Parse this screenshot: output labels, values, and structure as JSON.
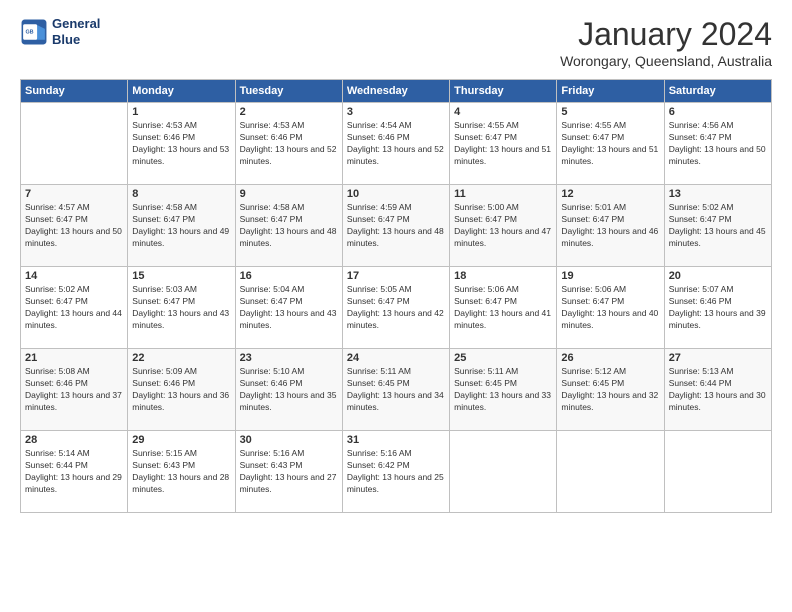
{
  "logo": {
    "line1": "General",
    "line2": "Blue"
  },
  "title": "January 2024",
  "subtitle": "Worongary, Queensland, Australia",
  "headers": [
    "Sunday",
    "Monday",
    "Tuesday",
    "Wednesday",
    "Thursday",
    "Friday",
    "Saturday"
  ],
  "weeks": [
    [
      null,
      {
        "day": "1",
        "sunrise": "4:53 AM",
        "sunset": "6:46 PM",
        "daylight": "13 hours and 53 minutes."
      },
      {
        "day": "2",
        "sunrise": "4:53 AM",
        "sunset": "6:46 PM",
        "daylight": "13 hours and 52 minutes."
      },
      {
        "day": "3",
        "sunrise": "4:54 AM",
        "sunset": "6:46 PM",
        "daylight": "13 hours and 52 minutes."
      },
      {
        "day": "4",
        "sunrise": "4:55 AM",
        "sunset": "6:47 PM",
        "daylight": "13 hours and 51 minutes."
      },
      {
        "day": "5",
        "sunrise": "4:55 AM",
        "sunset": "6:47 PM",
        "daylight": "13 hours and 51 minutes."
      },
      {
        "day": "6",
        "sunrise": "4:56 AM",
        "sunset": "6:47 PM",
        "daylight": "13 hours and 50 minutes."
      }
    ],
    [
      {
        "day": "7",
        "sunrise": "4:57 AM",
        "sunset": "6:47 PM",
        "daylight": "13 hours and 50 minutes."
      },
      {
        "day": "8",
        "sunrise": "4:58 AM",
        "sunset": "6:47 PM",
        "daylight": "13 hours and 49 minutes."
      },
      {
        "day": "9",
        "sunrise": "4:58 AM",
        "sunset": "6:47 PM",
        "daylight": "13 hours and 48 minutes."
      },
      {
        "day": "10",
        "sunrise": "4:59 AM",
        "sunset": "6:47 PM",
        "daylight": "13 hours and 48 minutes."
      },
      {
        "day": "11",
        "sunrise": "5:00 AM",
        "sunset": "6:47 PM",
        "daylight": "13 hours and 47 minutes."
      },
      {
        "day": "12",
        "sunrise": "5:01 AM",
        "sunset": "6:47 PM",
        "daylight": "13 hours and 46 minutes."
      },
      {
        "day": "13",
        "sunrise": "5:02 AM",
        "sunset": "6:47 PM",
        "daylight": "13 hours and 45 minutes."
      }
    ],
    [
      {
        "day": "14",
        "sunrise": "5:02 AM",
        "sunset": "6:47 PM",
        "daylight": "13 hours and 44 minutes."
      },
      {
        "day": "15",
        "sunrise": "5:03 AM",
        "sunset": "6:47 PM",
        "daylight": "13 hours and 43 minutes."
      },
      {
        "day": "16",
        "sunrise": "5:04 AM",
        "sunset": "6:47 PM",
        "daylight": "13 hours and 43 minutes."
      },
      {
        "day": "17",
        "sunrise": "5:05 AM",
        "sunset": "6:47 PM",
        "daylight": "13 hours and 42 minutes."
      },
      {
        "day": "18",
        "sunrise": "5:06 AM",
        "sunset": "6:47 PM",
        "daylight": "13 hours and 41 minutes."
      },
      {
        "day": "19",
        "sunrise": "5:06 AM",
        "sunset": "6:47 PM",
        "daylight": "13 hours and 40 minutes."
      },
      {
        "day": "20",
        "sunrise": "5:07 AM",
        "sunset": "6:46 PM",
        "daylight": "13 hours and 39 minutes."
      }
    ],
    [
      {
        "day": "21",
        "sunrise": "5:08 AM",
        "sunset": "6:46 PM",
        "daylight": "13 hours and 37 minutes."
      },
      {
        "day": "22",
        "sunrise": "5:09 AM",
        "sunset": "6:46 PM",
        "daylight": "13 hours and 36 minutes."
      },
      {
        "day": "23",
        "sunrise": "5:10 AM",
        "sunset": "6:46 PM",
        "daylight": "13 hours and 35 minutes."
      },
      {
        "day": "24",
        "sunrise": "5:11 AM",
        "sunset": "6:45 PM",
        "daylight": "13 hours and 34 minutes."
      },
      {
        "day": "25",
        "sunrise": "5:11 AM",
        "sunset": "6:45 PM",
        "daylight": "13 hours and 33 minutes."
      },
      {
        "day": "26",
        "sunrise": "5:12 AM",
        "sunset": "6:45 PM",
        "daylight": "13 hours and 32 minutes."
      },
      {
        "day": "27",
        "sunrise": "5:13 AM",
        "sunset": "6:44 PM",
        "daylight": "13 hours and 30 minutes."
      }
    ],
    [
      {
        "day": "28",
        "sunrise": "5:14 AM",
        "sunset": "6:44 PM",
        "daylight": "13 hours and 29 minutes."
      },
      {
        "day": "29",
        "sunrise": "5:15 AM",
        "sunset": "6:43 PM",
        "daylight": "13 hours and 28 minutes."
      },
      {
        "day": "30",
        "sunrise": "5:16 AM",
        "sunset": "6:43 PM",
        "daylight": "13 hours and 27 minutes."
      },
      {
        "day": "31",
        "sunrise": "5:16 AM",
        "sunset": "6:42 PM",
        "daylight": "13 hours and 25 minutes."
      },
      null,
      null,
      null
    ]
  ]
}
